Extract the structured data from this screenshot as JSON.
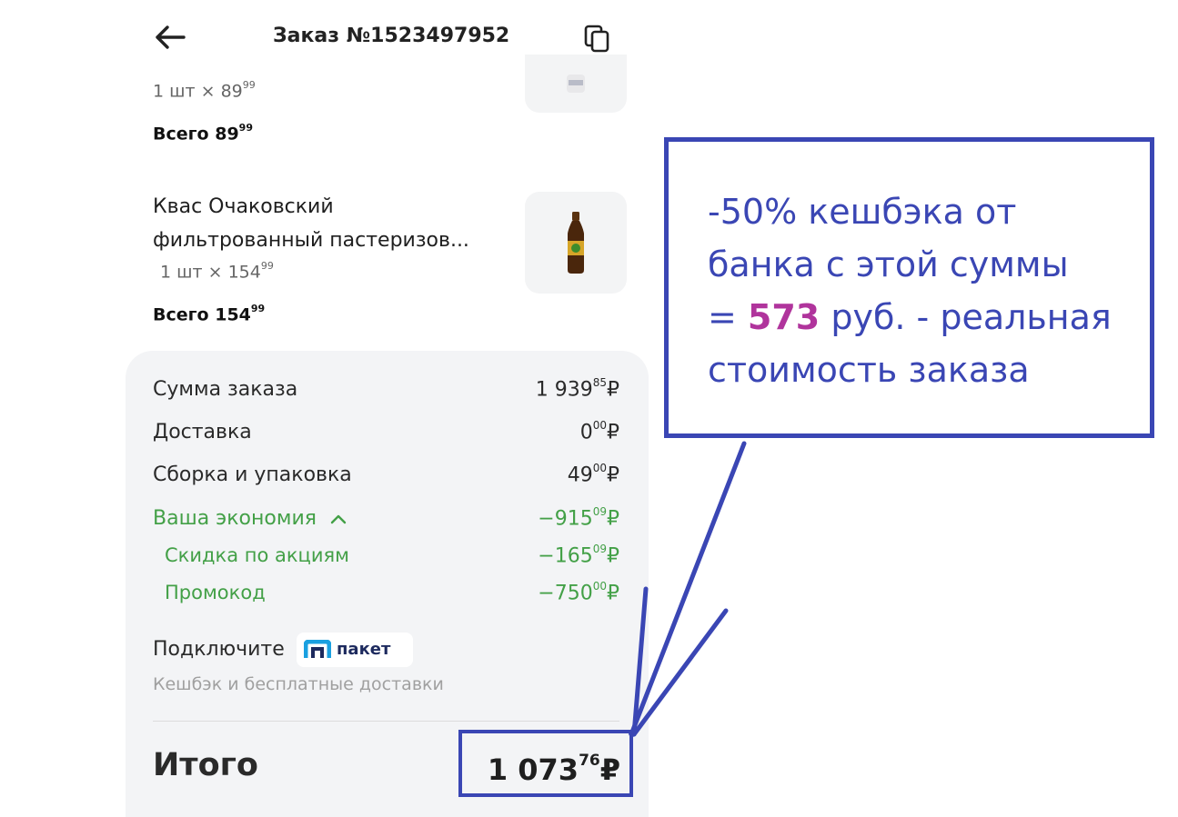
{
  "header": {
    "title": "Заказ №1523497952"
  },
  "items": [
    {
      "quantity_prefix": "1 шт × 89",
      "quantity_kopeks": "99",
      "total_prefix": "Всего 89",
      "total_kopeks": "99"
    },
    {
      "name_line1": "Квас Очаковский",
      "name_line2": "фильтрованный пастеризов...",
      "quantity_prefix": "1 шт × 154",
      "quantity_kopeks": "99",
      "total_prefix": "Всего 154",
      "total_kopeks": "99"
    }
  ],
  "summary": {
    "rows": [
      {
        "label": "Сумма заказа",
        "value": "1 939",
        "kopeks": "85",
        "currency": "₽"
      },
      {
        "label": "Доставка",
        "value": "0",
        "kopeks": "00",
        "currency": "₽"
      },
      {
        "label": "Сборка и упаковка",
        "value": "49",
        "kopeks": "00",
        "currency": "₽"
      }
    ],
    "savings": {
      "label": "Ваша экономия",
      "value": "−915",
      "kopeks": "09",
      "currency": "₽",
      "items": [
        {
          "label": "Скидка по акциям",
          "value": "−165",
          "kopeks": "09",
          "currency": "₽"
        },
        {
          "label": "Промокод",
          "value": "−750",
          "kopeks": "00",
          "currency": "₽"
        }
      ]
    },
    "promo": {
      "connect_label": "Подключите",
      "brand": "пакет",
      "subtitle": "Кешбэк и бесплатные доставки"
    },
    "total": {
      "label": "Итого",
      "value": "1 073",
      "kopeks": "76",
      "currency": "₽"
    }
  },
  "annotation": {
    "line1": "-50% кешбэка от",
    "line2": "банка с этой суммы",
    "line3_prefix": "= ",
    "line3_highlight": "573",
    "line3_suffix": " руб. - реальная",
    "line4": "стоимость заказа"
  },
  "colors": {
    "accent_green": "#43a047",
    "annotation_blue": "#3a46b4",
    "annotation_highlight": "#b0349c"
  },
  "icons": [
    "arrow-left-icon",
    "copy-icon",
    "chevron-up-icon",
    "paket-logo-icon"
  ]
}
